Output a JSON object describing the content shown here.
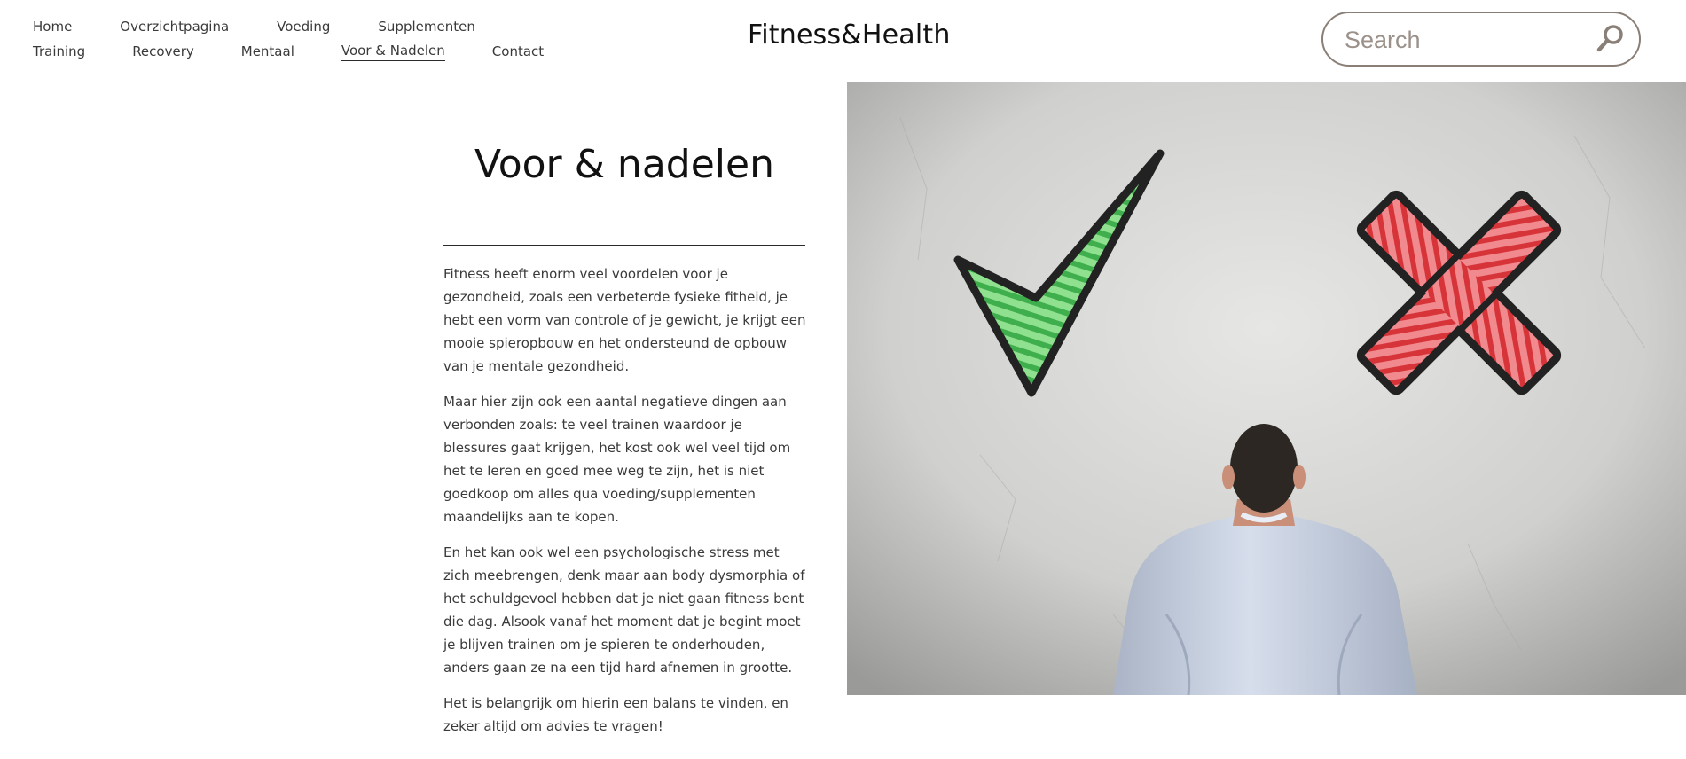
{
  "nav": {
    "row1": [
      "Home",
      "Overzichtpagina",
      "Voeding",
      "Supplementen"
    ],
    "row2": [
      "Training",
      "Recovery",
      "Mentaal",
      "Voor & Nadelen",
      "Contact"
    ],
    "active": "Voor & Nadelen"
  },
  "site": {
    "title": "Fitness&Health"
  },
  "search": {
    "placeholder": "Search",
    "value": ""
  },
  "main": {
    "heading": "Voor & nadelen",
    "paragraphs": [
      "Fitness heeft enorm veel voordelen voor je gezondheid, zoals een verbeterde fysieke fitheid, je hebt een vorm van controle of je gewicht, je krijgt een mooie spieropbouw en het ondersteund de opbouw van je mentale gezondheid.",
      "Maar hier zijn ook een aantal negatieve dingen aan verbonden zoals: te veel trainen waardoor je blessures gaat krijgen, het kost ook wel veel tijd om het te leren en goed mee weg te zijn, het is niet goedkoop om alles qua voeding/supplementen maandelijks aan te kopen.",
      "En het kan ook wel een psychologische stress met zich meebrengen, denk maar aan body dysmorphia of het schuldgevoel hebben dat je niet gaan fitness bent die dag. Alsook vanaf het moment dat je begint moet je blijven trainen om je spieren te onderhouden, anders gaan ze na een tijd hard afnemen in grootte.",
      "Het is belangrijk om hierin een balans te vinden, en zeker altijd om advies te vragen!"
    ]
  },
  "hero": {
    "icons": [
      "checkmark-icon",
      "cross-icon"
    ],
    "colors": {
      "wall": "#c8c8c6",
      "check": "#5fcf6a",
      "cross": "#e2484c",
      "shirt": "#c9d2e2",
      "hair": "#2d2723"
    }
  }
}
